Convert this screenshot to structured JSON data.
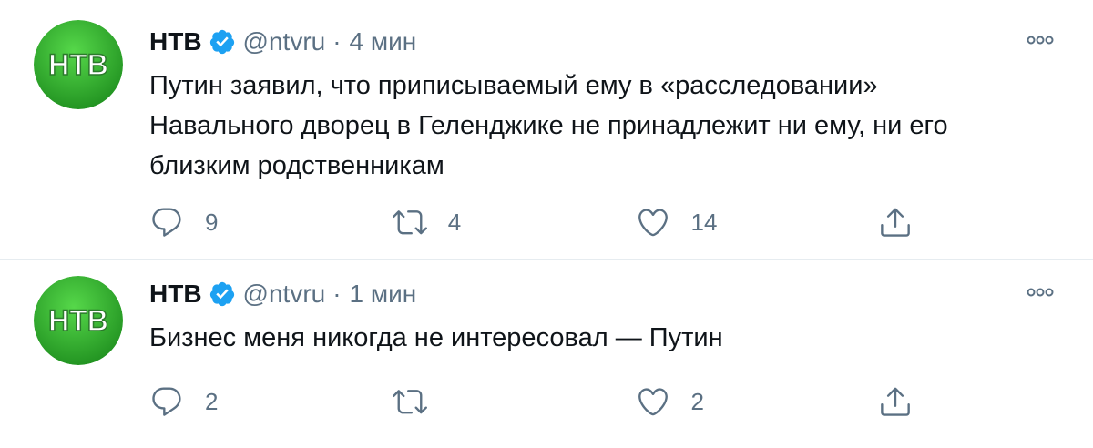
{
  "tweets": [
    {
      "name": "НТВ",
      "handle": "@ntvru",
      "separator": "·",
      "time": "4 мин",
      "text": "Путин заявил, что приписываемый ему в «расследовании»\nНавального дворец в Геленджике не принадлежит ни ему, ни его\nблизким родственникам",
      "replies": "9",
      "retweets": "4",
      "likes": "14",
      "avatar_logo": "НТВ"
    },
    {
      "name": "НТВ",
      "handle": "@ntvru",
      "separator": "·",
      "time": "1 мин",
      "text": "Бизнес меня никогда не интересовал — Путин",
      "replies": "2",
      "retweets": "",
      "likes": "2",
      "avatar_logo": "НТВ"
    }
  ],
  "colors": {
    "avatar_green": "#2aa62a",
    "verified_blue": "#1da1f2",
    "secondary_text": "#5b7083",
    "divider": "#e6ecf0"
  },
  "icons": [
    "verified-badge-icon",
    "more-options-icon",
    "reply-icon",
    "retweet-icon",
    "like-icon",
    "share-icon"
  ]
}
